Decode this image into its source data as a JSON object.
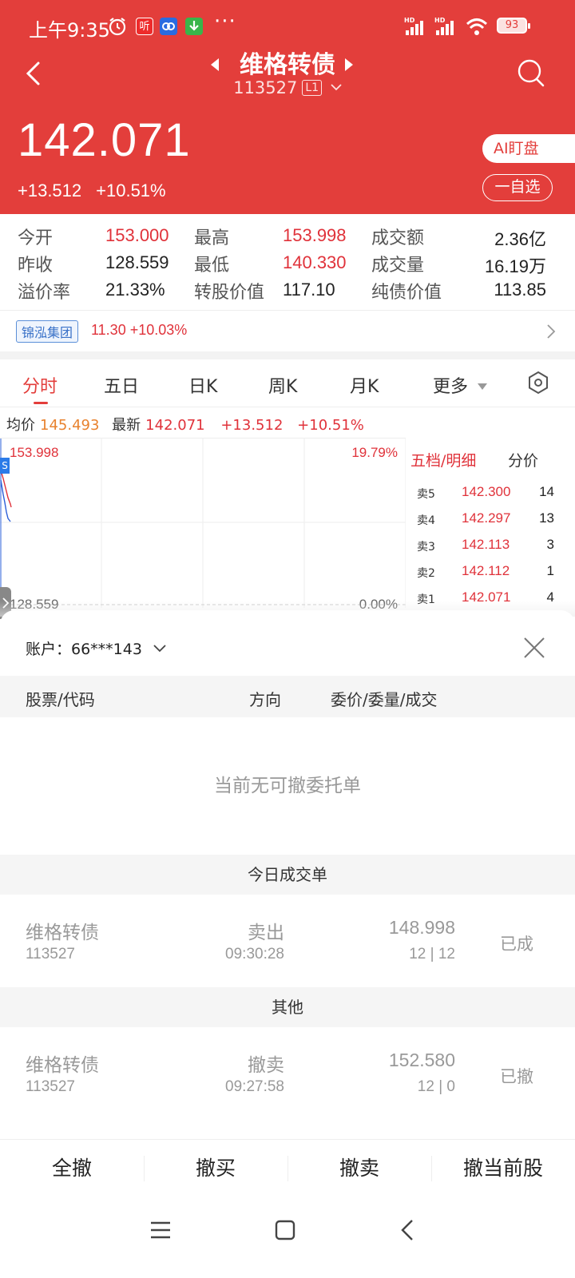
{
  "status_bar": {
    "time": "上午9:35",
    "app_icon_1": "听",
    "dots": "···",
    "battery": "93"
  },
  "header": {
    "title": "维格转债",
    "code": "113527",
    "level": "L1",
    "price": "142.071",
    "change": "+13.512",
    "change_pct": "+10.51%",
    "ai_button": "AI盯盘",
    "fav_button": "一自选",
    "bg_color": "#e33e3b"
  },
  "quote": {
    "open_label": "今开",
    "open": "153.000",
    "high_label": "最高",
    "high": "153.998",
    "amount_label": "成交额",
    "amount": "2.36亿",
    "prev_label": "昨收",
    "prev": "128.559",
    "low_label": "最低",
    "low": "140.330",
    "volume_label": "成交量",
    "volume": "16.19万",
    "premium_label": "溢价率",
    "premium": "21.33%",
    "conv_label": "转股价值",
    "conv": "117.10",
    "bond_label": "纯债价值",
    "bond": "113.85"
  },
  "related": {
    "name": "锦泓集团",
    "value": "11.30 +10.03%"
  },
  "tabs": [
    {
      "label": "分时"
    },
    {
      "label": "五日"
    },
    {
      "label": "日K"
    },
    {
      "label": "周K"
    },
    {
      "label": "月K"
    },
    {
      "label": "更多"
    }
  ],
  "avg_line": {
    "avg_label": "均价",
    "avg": "145.493",
    "last_label": "最新",
    "last": "142.071",
    "change": "+13.512",
    "change_pct": "+10.51%"
  },
  "chart": {
    "high_label": "153.998",
    "high_pct": "19.79%",
    "base_label": "128.559",
    "base_pct": "0.00%"
  },
  "order_book": {
    "tab1": "五档/明细",
    "tab2": "分价",
    "rows": [
      {
        "label": "卖5",
        "price": "142.300",
        "qty": "14"
      },
      {
        "label": "卖4",
        "price": "142.297",
        "qty": "13"
      },
      {
        "label": "卖3",
        "price": "142.113",
        "qty": "3"
      },
      {
        "label": "卖2",
        "price": "142.112",
        "qty": "1"
      },
      {
        "label": "卖1",
        "price": "142.071",
        "qty": "4"
      }
    ]
  },
  "sheet": {
    "account_label": "账户：66***143",
    "col_stock": "股票/代码",
    "col_dir": "方向",
    "col_price": "委价/委量/成交",
    "empty_text": "当前无可撤委托单",
    "today_section": "今日成交单",
    "other_section": "其他",
    "today_rows": [
      {
        "name": "维格转债",
        "code": "113527",
        "dir": "卖出",
        "time": "09:30:28",
        "price": "148.998",
        "qty": "12 | 12",
        "status": "已成"
      }
    ],
    "other_rows": [
      {
        "name": "维格转债",
        "code": "113527",
        "dir": "撤卖",
        "time": "09:27:58",
        "price": "152.580",
        "qty": "12 | 0",
        "status": "已撤"
      }
    ]
  },
  "actions": {
    "all": "全撤",
    "buy": "撤买",
    "sell": "撤卖",
    "current": "撤当前股"
  }
}
